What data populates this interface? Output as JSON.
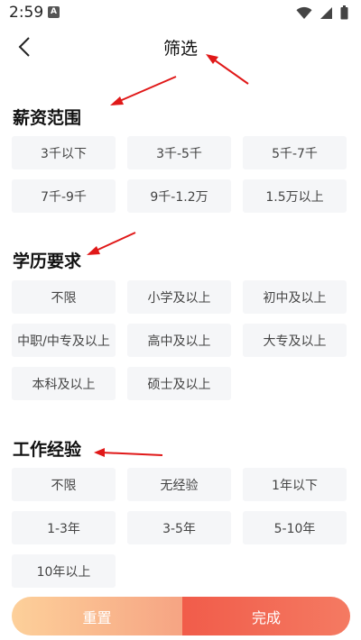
{
  "status": {
    "time": "2:59",
    "notification_letter": "A",
    "icons": [
      "wifi-icon",
      "signal-icon",
      "battery-icon"
    ]
  },
  "header": {
    "title": "筛选",
    "back_icon": "chevron-left-icon"
  },
  "sections": {
    "salary": {
      "title": "薪资范围",
      "options": [
        "3千以下",
        "3千-5千",
        "5千-7千",
        "7千-9千",
        "9千-1.2万",
        "1.5万以上"
      ]
    },
    "education": {
      "title": "学历要求",
      "options": [
        "不限",
        "小学及以上",
        "初中及以上",
        "中职/中专及以上",
        "高中及以上",
        "大专及以上",
        "本科及以上",
        "硕士及以上"
      ]
    },
    "experience": {
      "title": "工作经验",
      "options": [
        "不限",
        "无经验",
        "1年以下",
        "1-3年",
        "3-5年",
        "5-10年",
        "10年以上"
      ]
    }
  },
  "footer": {
    "reset_label": "重置",
    "done_label": "完成"
  },
  "colors": {
    "annotation_arrow": "#e01818",
    "option_bg": "#f5f6f8",
    "done_button": "#f15c4a",
    "reset_button": "#fdd09a"
  }
}
